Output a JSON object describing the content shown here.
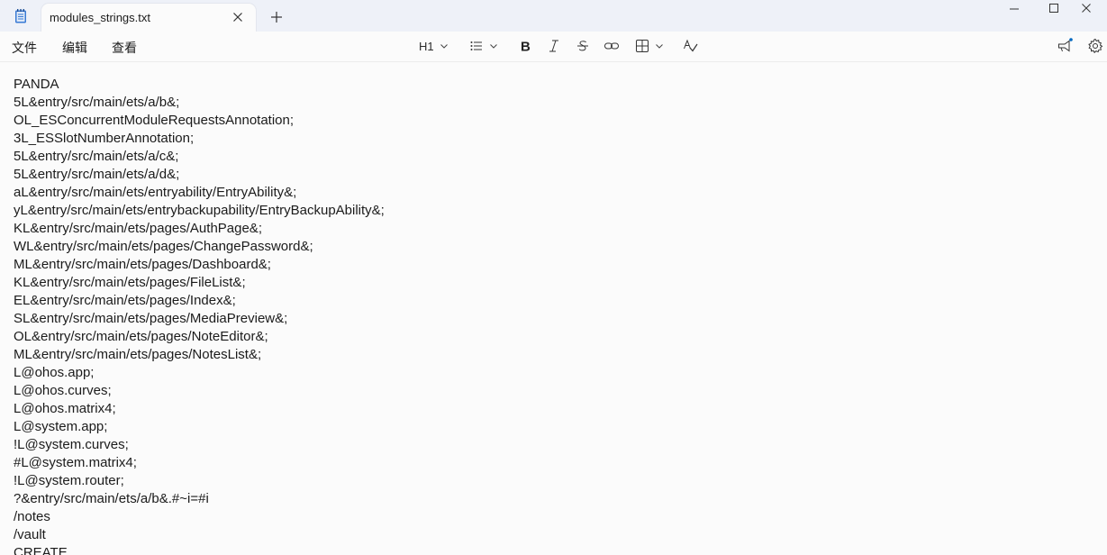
{
  "tab": {
    "title": "modules_strings.txt"
  },
  "menu": {
    "file": "文件",
    "edit": "编辑",
    "view": "查看"
  },
  "toolbar": {
    "heading": "H1"
  },
  "icons": {
    "app": "notepad-icon",
    "close": "close-icon",
    "new_tab": "plus-icon",
    "minimize": "minimize-icon",
    "maximize": "maximize-icon",
    "window_close": "close-icon",
    "list": "list-icon",
    "bold": "bold-icon",
    "italic": "italic-icon",
    "strike": "strikethrough-icon",
    "link": "link-icon",
    "table": "table-icon",
    "spellcheck": "spellcheck-icon",
    "megaphone": "megaphone-icon",
    "settings": "gear-icon"
  },
  "colors": {
    "titlebar": "#eef1f8",
    "accent": "#0067c0",
    "text": "#1b1b1b"
  },
  "content": {
    "lines": [
      "PANDA",
      "5L&entry/src/main/ets/a/b&;",
      "OL_ESConcurrentModuleRequestsAnnotation;",
      "3L_ESSlotNumberAnnotation;",
      "5L&entry/src/main/ets/a/c&;",
      "5L&entry/src/main/ets/a/d&;",
      "aL&entry/src/main/ets/entryability/EntryAbility&;",
      "yL&entry/src/main/ets/entrybackupability/EntryBackupAbility&;",
      "KL&entry/src/main/ets/pages/AuthPage&;",
      "WL&entry/src/main/ets/pages/ChangePassword&;",
      "ML&entry/src/main/ets/pages/Dashboard&;",
      "KL&entry/src/main/ets/pages/FileList&;",
      "EL&entry/src/main/ets/pages/Index&;",
      "SL&entry/src/main/ets/pages/MediaPreview&;",
      "OL&entry/src/main/ets/pages/NoteEditor&;",
      "ML&entry/src/main/ets/pages/NotesList&;",
      "L@ohos.app;",
      "L@ohos.curves;",
      "L@ohos.matrix4;",
      "L@system.app;",
      "!L@system.curves;",
      "#L@system.matrix4;",
      "!L@system.router;",
      "?&entry/src/main/ets/a/b&.#~i=#i",
      "/notes",
      "/vault",
      "CREATE"
    ]
  }
}
